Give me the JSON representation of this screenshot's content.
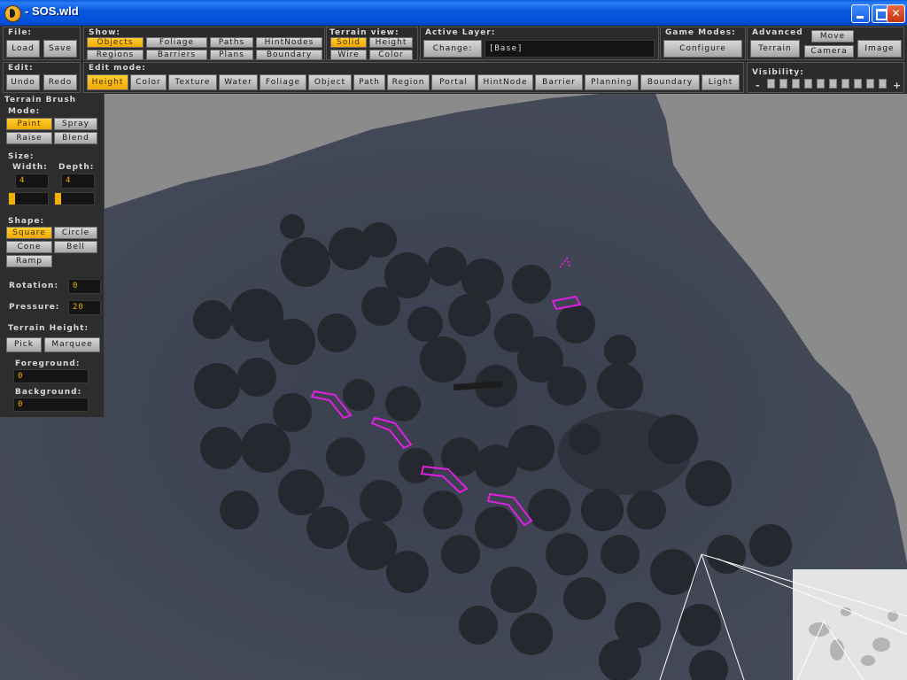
{
  "window": {
    "title": "- SOS.wld"
  },
  "file": {
    "label": "File:",
    "load": "Load",
    "save": "Save"
  },
  "edit": {
    "label": "Edit:",
    "undo": "Undo",
    "redo": "Redo"
  },
  "show": {
    "label": "Show:",
    "objects": "Objects",
    "foliage": "Foliage",
    "paths": "Paths",
    "hintnodes": "HintNodes",
    "regions": "Regions",
    "barriers": "Barriers",
    "plans": "Plans",
    "boundary": "Boundary"
  },
  "terrain_view": {
    "label": "Terrain view:",
    "solid": "Solid",
    "height": "Height",
    "wire": "Wire",
    "color": "Color"
  },
  "active_layer": {
    "label": "Active Layer:",
    "change": "Change:",
    "value": "[Base]"
  },
  "game_modes": {
    "label": "Game Modes:",
    "configure": "Configure"
  },
  "advanced": {
    "label": "Advanced",
    "terrain": "Terrain",
    "move": "Move",
    "camera": "Camera",
    "image": "Image"
  },
  "visibility": {
    "label": "Visibility:",
    "minus": "-",
    "plus": "+"
  },
  "edit_mode": {
    "label": "Edit mode:",
    "height": "Height",
    "color": "Color",
    "texture": "Texture",
    "water": "Water",
    "foliage": "Foliage",
    "object": "Object",
    "path": "Path",
    "region": "Region",
    "portal": "Portal",
    "hintnode": "HintNode",
    "barrier": "Barrier",
    "planning": "Planning",
    "boundary": "Boundary",
    "light": "Light"
  },
  "brush": {
    "title": "Terrain Brush",
    "mode_label": "Mode:",
    "paint": "Paint",
    "spray": "Spray",
    "raise": "Raise",
    "blend": "Blend",
    "size_label": "Size:",
    "width_label": "Width:",
    "depth_label": "Depth:",
    "width_value": "4",
    "depth_value": "4",
    "shape_label": "Shape:",
    "square": "Square",
    "circle": "Circle",
    "cone": "Cone",
    "bell": "Bell",
    "ramp": "Ramp",
    "rotation_label": "Rotation:",
    "rotation_value": "0",
    "pressure_label": "Pressure:",
    "pressure_value": "20",
    "terrain_height_label": "Terrain Height:",
    "pick": "Pick",
    "marquee": "Marquee",
    "foreground_label": "Foreground:",
    "foreground_value": "0",
    "background_label": "Background:",
    "background_value": "0"
  },
  "colors": {
    "accent": "#f5b800",
    "barrier": "#e020e0",
    "terrain": "#3c4150",
    "panel": "#2e2e2e"
  },
  "icons": [
    "app-icon",
    "minimize-icon",
    "maximize-icon",
    "close-icon"
  ]
}
